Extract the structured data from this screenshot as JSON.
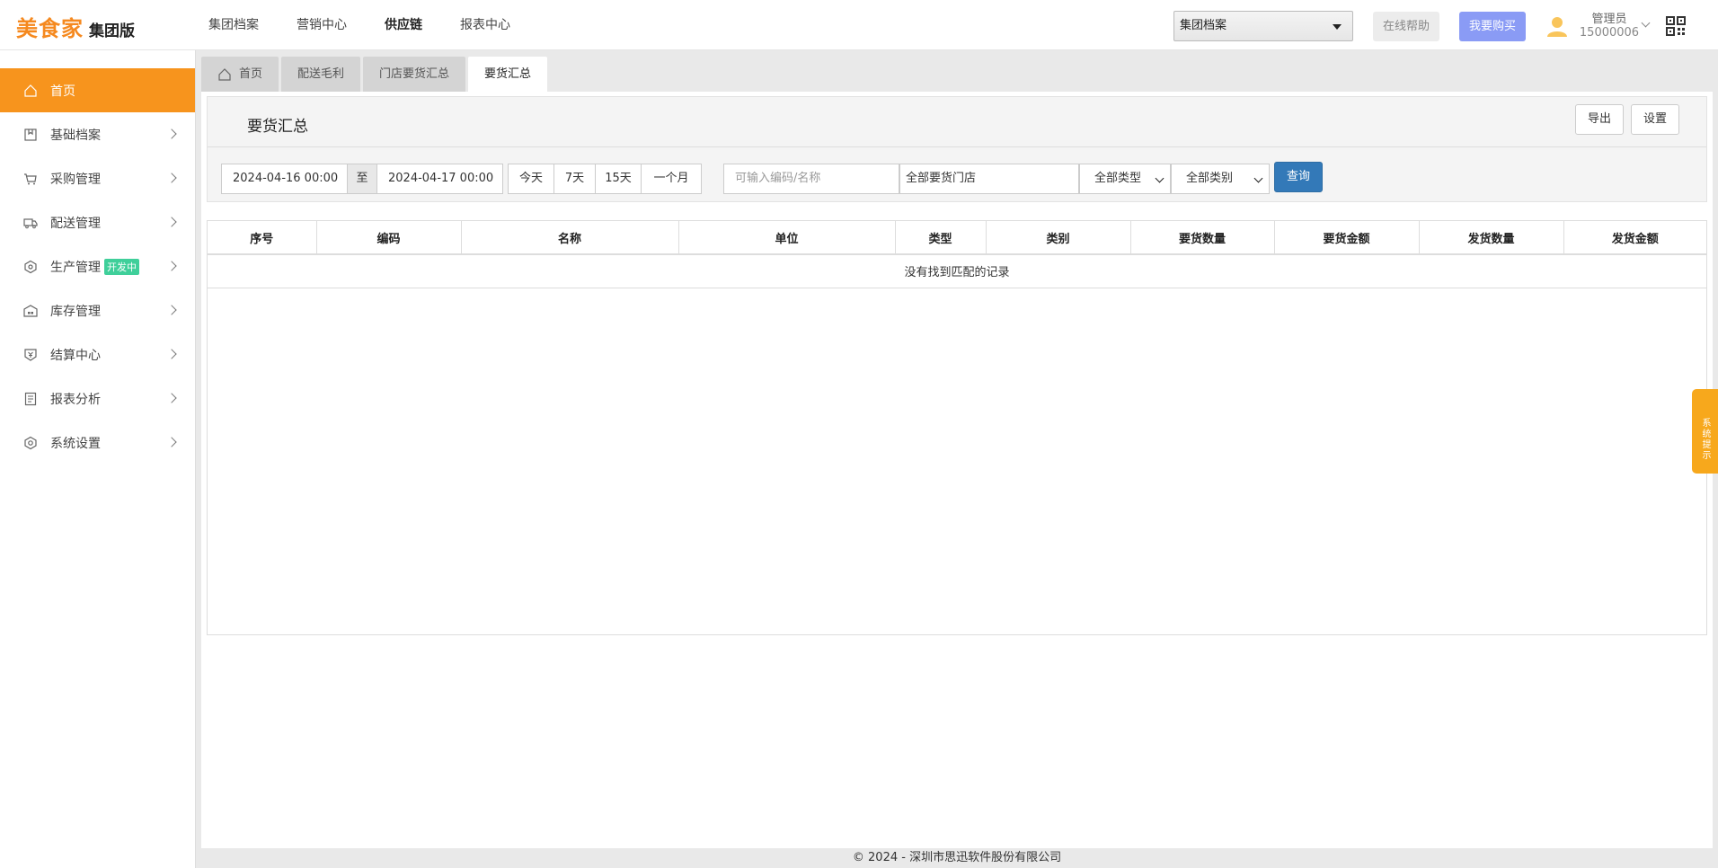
{
  "header": {
    "brand": "美食家",
    "edition": "集团版",
    "nav": [
      {
        "label": "集团档案",
        "active": false
      },
      {
        "label": "营销中心",
        "active": false
      },
      {
        "label": "供应链",
        "active": true
      },
      {
        "label": "报表中心",
        "active": false
      }
    ],
    "group_select": "集团档案",
    "help_label": "在线帮助",
    "buy_label": "我要购买",
    "user_name": "管理员",
    "user_id": "15000006"
  },
  "sidebar": {
    "items": [
      {
        "label": "首页",
        "icon": "home-icon",
        "active": true
      },
      {
        "label": "基础档案",
        "icon": "archive-icon"
      },
      {
        "label": "采购管理",
        "icon": "cart-icon"
      },
      {
        "label": "配送管理",
        "icon": "truck-icon"
      },
      {
        "label": "生产管理",
        "icon": "production-icon",
        "badge": "开发中"
      },
      {
        "label": "库存管理",
        "icon": "warehouse-icon"
      },
      {
        "label": "结算中心",
        "icon": "settlement-icon"
      },
      {
        "label": "报表分析",
        "icon": "report-icon"
      },
      {
        "label": "系统设置",
        "icon": "settings-icon"
      }
    ]
  },
  "tabs": [
    {
      "label": "首页",
      "active": false
    },
    {
      "label": "配送毛利",
      "active": false
    },
    {
      "label": "门店要货汇总",
      "active": false
    },
    {
      "label": "要货汇总",
      "active": true
    }
  ],
  "page": {
    "title": "要货汇总",
    "export_label": "导出",
    "settings_label": "设置"
  },
  "filters": {
    "start_date": "2024-04-16 00:00",
    "to_label": "至",
    "end_date": "2024-04-17 00:00",
    "quick_ranges": [
      "今天",
      "7天",
      "15天",
      "一个月"
    ],
    "search_placeholder": "可输入编码/名称",
    "store_value": "全部要货门店",
    "type_value": "全部类型",
    "category_value": "全部类别",
    "query_label": "查询"
  },
  "table": {
    "columns": [
      "序号",
      "编码",
      "名称",
      "单位",
      "类型",
      "类别",
      "要货数量",
      "要货金额",
      "发货数量",
      "发货金额"
    ],
    "empty_text": "没有找到匹配的记录"
  },
  "footer": "© 2024 - 深圳市思迅软件股份有限公司",
  "system_tip": "系统提示",
  "colors": {
    "accent": "#f7941d",
    "query_button": "#3379b8",
    "buy_button": "#8a9bf5",
    "badge": "#3fcf9a"
  }
}
